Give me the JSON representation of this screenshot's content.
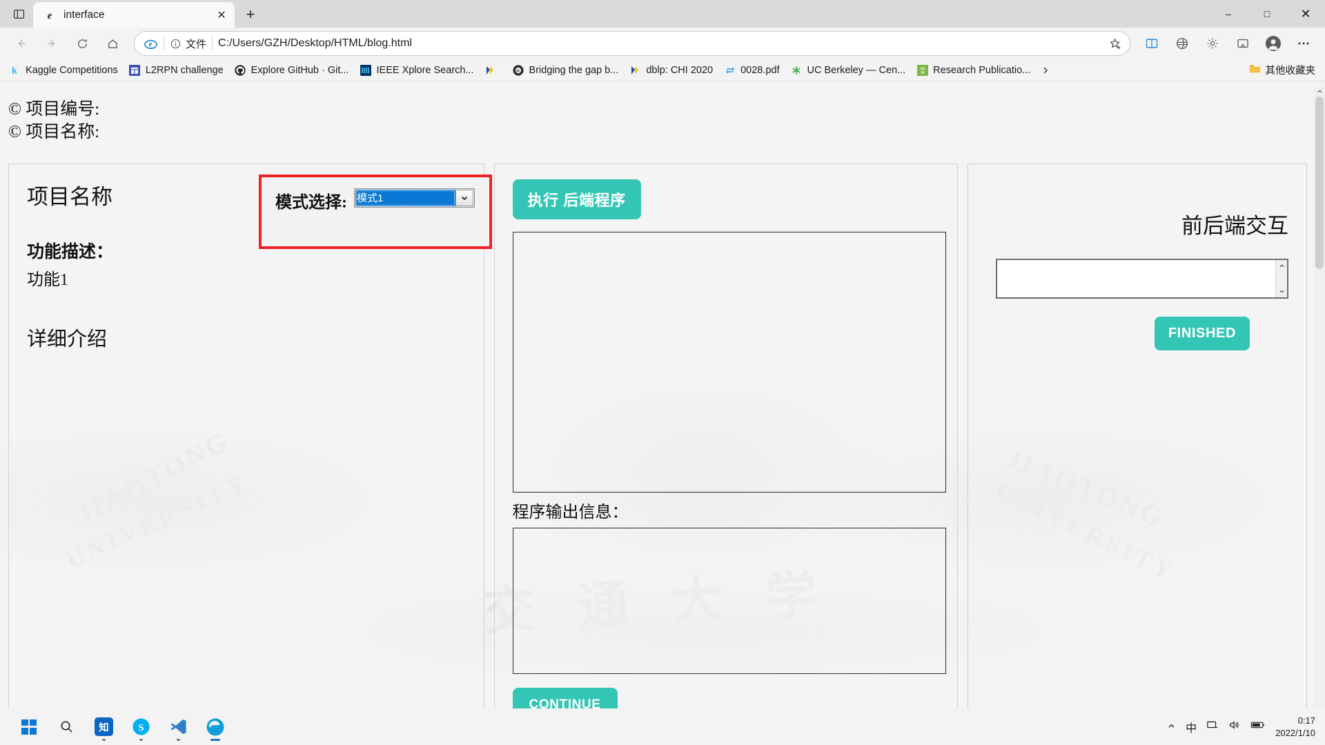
{
  "browser": {
    "tab": {
      "title": "interface",
      "favicon_icon": "ie-e-icon",
      "close_icon": "close-icon"
    },
    "tab_list_icon": "tab-list-icon",
    "new_tab_icon": "plus-icon",
    "window_controls": {
      "minimize": "–",
      "maximize": "□",
      "close": "✕"
    },
    "nav": {
      "back_icon": "arrow-left-icon",
      "forward_icon": "arrow-right-icon",
      "refresh_icon": "refresh-icon",
      "home_icon": "home-icon"
    },
    "omnibox": {
      "ie_mode_icon": "internet-explorer-icon",
      "info_icon": "info-circle-icon",
      "scheme_label": "文件",
      "url": "C:/Users/GZH/Desktop/HTML/blog.html",
      "favorite_icon": "star-plus-icon"
    },
    "toolbar_icons": [
      "split-screen-icon",
      "collections-icon",
      "settings-gear-icon",
      "browser-essentials-icon",
      "profile-avatar-icon",
      "more-ellipsis-icon"
    ],
    "bookmarks": [
      {
        "label": "Kaggle Competitions",
        "icon": "kaggle-k-icon",
        "color": "#20beff"
      },
      {
        "label": "L2RPN challenge",
        "icon": "l2rpn-icon",
        "color": "#3f51b5"
      },
      {
        "label": "Explore GitHub · Git...",
        "icon": "github-icon",
        "color": "#1b1f23"
      },
      {
        "label": "IEEE Xplore Search...",
        "icon": "ieee-icon",
        "color": "#00619b"
      },
      {
        "label": "",
        "icon": "acrobat-pdf-icon",
        "color": "#f2b705"
      },
      {
        "label": "Bridging the gap b...",
        "icon": "acm-dl-icon",
        "color": "#2b2b2b"
      },
      {
        "label": "dblp: CHI 2020",
        "icon": "dblp-icon",
        "color": "#f2b705"
      },
      {
        "label": "0028.pdf",
        "icon": "sync-pdf-icon",
        "color": "#2e9bf0"
      },
      {
        "label": "UC Berkeley — Cen...",
        "icon": "uc-berkeley-icon",
        "color": "#3aae4a"
      },
      {
        "label": "Research Publicatio...",
        "icon": "chai-icon",
        "color": "#7ab648"
      }
    ],
    "bookmarks_overflow_icon": "chevron-right-icon",
    "other_favorites": {
      "label": "其他收藏夹",
      "icon": "folder-icon"
    }
  },
  "page": {
    "header_lines": [
      "© 项目编号:",
      "© 项目名称:"
    ],
    "left_panel": {
      "project_title": "项目名称",
      "feature_desc_label": "功能描述：",
      "feature_desc_value": "功能1",
      "detail_label": "详细介绍"
    },
    "mode_box": {
      "label": "模式选择:",
      "selected": "模式1",
      "options": [
        "模式1"
      ],
      "border_color": "#f02027",
      "select_highlight_color": "#0a78d4",
      "dropdown_icon": "chevron-down-icon"
    },
    "mid_panel": {
      "run_button": "执行 后端程序",
      "output_label": "程序输出信息：",
      "continue_button": "CONTINUE",
      "display_box_value": "",
      "output_box_value": ""
    },
    "right_panel": {
      "title": "前后端交互",
      "textarea_value": "",
      "finished_button": "FINISHED",
      "scroll_up_icon": "chevron-up-icon",
      "scroll_down_icon": "chevron-down-icon"
    },
    "watermark": {
      "arch_left_top": "JIAOTONG",
      "arch_left_bottom": "UNIVERSITY",
      "arch_right_top": "JIAOTONG",
      "arch_right_bottom": "UNIVERSITY",
      "chinese": "交 通 大 学"
    },
    "accent_color": "#34c6b4",
    "scrollbar": {
      "up_icon": "chevron-up-icon",
      "down_icon": "chevron-down-icon"
    }
  },
  "taskbar": {
    "start_icon": "windows-start-icon",
    "search_icon": "search-icon",
    "items": [
      {
        "icon": "zhihu-app-icon",
        "color": "#0a66c2"
      },
      {
        "icon": "skype-app-icon",
        "color": "#00aff0"
      },
      {
        "icon": "vscode-app-icon",
        "color": "#2f80c7"
      },
      {
        "icon": "edge-app-icon",
        "color": "#0f9ed8"
      }
    ],
    "tray": {
      "chevron_icon": "chevron-up-icon",
      "ime_label": "中",
      "network_icon": "network-icon",
      "volume_icon": "volume-icon",
      "battery_icon": "battery-icon"
    },
    "clock": {
      "time": "0:17",
      "date": "2022/1/10"
    }
  }
}
